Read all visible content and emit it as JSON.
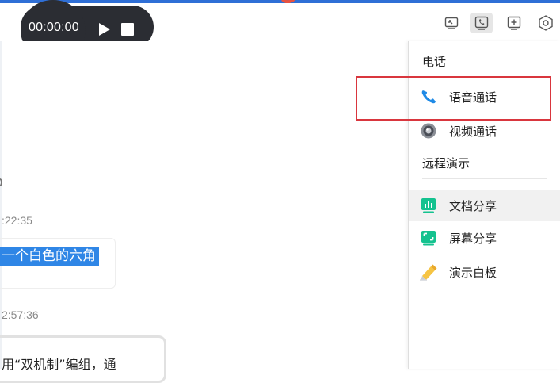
{
  "recorder": {
    "time": "00:00:00",
    "icons": [
      "play-icon",
      "stop-icon"
    ]
  },
  "header": {
    "buttons": [
      {
        "name": "exit-to-window-icon"
      },
      {
        "name": "phone-icon",
        "active": true
      },
      {
        "name": "add-icon"
      },
      {
        "name": "hexagon-settings-icon"
      }
    ]
  },
  "chat": {
    "timestamps": [
      ":22:35",
      "2:57:36"
    ],
    "selected_text": "一个白色的六角",
    "message_fragment": "用“双机制”编组，通"
  },
  "panel": {
    "phone_section": "电话",
    "phone_items": [
      {
        "label": "语音通话",
        "icon": "phone-handset-icon"
      },
      {
        "label": "视频通话",
        "icon": "camera-lens-icon"
      }
    ],
    "remote_section": "远程演示",
    "remote_items": [
      {
        "label": "文档分享",
        "icon": "document-share-icon"
      },
      {
        "label": "屏幕分享",
        "icon": "screen-share-icon"
      },
      {
        "label": "演示白板",
        "icon": "whiteboard-pencil-icon"
      }
    ]
  },
  "colors": {
    "accent_blue": "#2f86e6",
    "highlight_red": "#d9363e",
    "recorder_bg": "#2b2d33",
    "share_green": "#14c28f"
  }
}
